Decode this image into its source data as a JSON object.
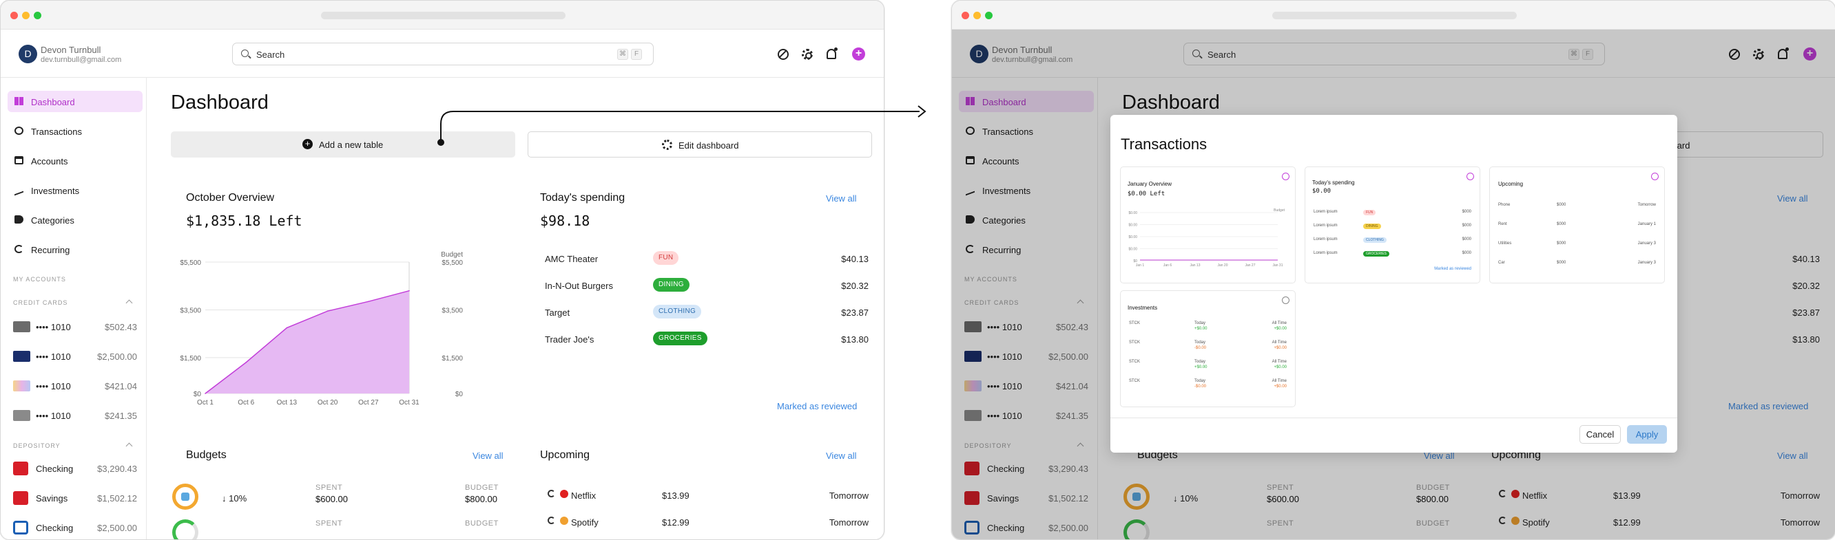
{
  "user": {
    "initial": "D",
    "name": "Devon Turnbull",
    "email": "dev.turnbull@gmail.com"
  },
  "search": {
    "placeholder": "Search",
    "shortcut_key1": "⌘",
    "shortcut_key2": "F"
  },
  "nav": [
    {
      "label": "Dashboard",
      "icon": "dashboard-icon"
    },
    {
      "label": "Transactions",
      "icon": "transactions-icon"
    },
    {
      "label": "Accounts",
      "icon": "accounts-icon"
    },
    {
      "label": "Investments",
      "icon": "investments-icon"
    },
    {
      "label": "Categories",
      "icon": "categories-icon"
    },
    {
      "label": "Recurring",
      "icon": "recurring-icon"
    }
  ],
  "sidebar": {
    "my_accounts": "MY ACCOUNTS",
    "credit_cards": "CREDIT CARDS",
    "depository": "DEPOSITORY",
    "cards": [
      {
        "name": "•••• 1010",
        "balance": "$502.43",
        "color": "#6b6b6b"
      },
      {
        "name": "•••• 1010",
        "balance": "$2,500.00",
        "color": "#1a2e6b"
      },
      {
        "name": "•••• 1010",
        "balance": "$421.04",
        "color": "#e8b4e6"
      },
      {
        "name": "•••• 1010",
        "balance": "$241.35",
        "color": "#8a8a8a"
      }
    ],
    "deposits": [
      {
        "name": "Checking",
        "balance": "$3,290.43",
        "bank": "wells-fargo"
      },
      {
        "name": "Savings",
        "balance": "$1,502.12",
        "bank": "wells-fargo"
      },
      {
        "name": "Checking",
        "balance": "$2,500.00",
        "bank": "chase"
      }
    ]
  },
  "dashboard": {
    "title": "Dashboard",
    "add_table": "Add a new table",
    "edit_dashboard": "Edit dashboard",
    "overview": {
      "title": "October Overview",
      "amount": "$1,835.18 Left"
    },
    "spending": {
      "title": "Today's spending",
      "amount": "$98.18",
      "view_all": "View all",
      "marked": "Marked as reviewed",
      "rows": [
        {
          "name": "AMC Theater",
          "badge": "FUN",
          "amount": "$40.13"
        },
        {
          "name": "In-N-Out Burgers",
          "badge": "DINING",
          "amount": "$20.32"
        },
        {
          "name": "Target",
          "badge": "CLOTHING",
          "amount": "$23.87"
        },
        {
          "name": "Trader Joe's",
          "badge": "GROCERIES",
          "amount": "$13.80"
        }
      ]
    },
    "budgets": {
      "title": "Budgets",
      "view_all": "View all",
      "spent_label": "SPENT",
      "budget_label": "BUDGET",
      "rows": [
        {
          "pct": "↓ 10%",
          "spent": "$600.00",
          "budget": "$800.00"
        }
      ]
    },
    "upcoming": {
      "title": "Upcoming",
      "view_all": "View all",
      "rows": [
        {
          "name": "Netflix",
          "amount": "$13.99",
          "when": "Tomorrow"
        },
        {
          "name": "Spotify",
          "amount": "$12.99",
          "when": "Tomorrow"
        }
      ]
    }
  },
  "chart_data": {
    "type": "area",
    "x": [
      "Oct 1",
      "Oct 6",
      "Oct 13",
      "Oct 20",
      "Oct 27",
      "Oct 31"
    ],
    "values": [
      0,
      1300,
      2750,
      3450,
      3850,
      4300
    ],
    "y_ticks": [
      "$0",
      "$1,500",
      "$3,500",
      "$5,500"
    ],
    "right_ticks": [
      "$0",
      "$1,500",
      "$3,500",
      "$5,500"
    ],
    "right_title": "Budget",
    "ylim": [
      0,
      5500
    ],
    "color": "#e6b9f3"
  },
  "modal": {
    "title": "Transactions",
    "cancel": "Cancel",
    "apply": "Apply",
    "cards": {
      "overview": {
        "title": "January Overview",
        "amount": "$0.00 Left",
        "budget": "Budget"
      },
      "spending": {
        "title": "Today's spending",
        "amount": "$0.00",
        "marked": "Marked as reviewed"
      },
      "upcoming": {
        "title": "Upcoming"
      },
      "investments": {
        "title": "Investments"
      }
    },
    "overview_y": [
      "$0.00",
      "$0.00",
      "$0.00",
      "$0.00",
      "$0"
    ],
    "overview_x": [
      "Jan 1",
      "Jan 6",
      "Jan 13",
      "Jan 20",
      "Jan 27",
      "Jan 31"
    ],
    "spending_rows": [
      {
        "name": "Lorem ipsum",
        "badge": "FUN",
        "amount": "$000"
      },
      {
        "name": "Lorem ipsum",
        "badge": "DINING",
        "amount": "$000"
      },
      {
        "name": "Lorem ipsum",
        "badge": "CLOTHING",
        "amount": "$000"
      },
      {
        "name": "Lorem ipsum",
        "badge": "GROCERIES",
        "amount": "$000"
      }
    ],
    "upcoming_rows": [
      {
        "name": "Phone",
        "amount": "$000",
        "when": "Tomorrow"
      },
      {
        "name": "Rent",
        "amount": "$000",
        "when": "January 1"
      },
      {
        "name": "Utilities",
        "amount": "$000",
        "when": "January 3"
      },
      {
        "name": "Car",
        "amount": "$000",
        "when": "January 3"
      }
    ],
    "invest_rows": [
      {
        "name": "STCK",
        "today": "Today",
        "today_val": "+$0.00",
        "all": "All Time",
        "all_val": "+$0.00"
      },
      {
        "name": "STCK",
        "today": "Today",
        "today_val": "-$0.00",
        "all": "All Time",
        "all_val": "+$0.00"
      },
      {
        "name": "STCK",
        "today": "Today",
        "today_val": "+$0.00",
        "all": "All Time",
        "all_val": "+$0.00"
      },
      {
        "name": "STCK",
        "today": "Today",
        "today_val": "-$0.00",
        "all": "All Time",
        "all_val": "+$0.00"
      }
    ]
  }
}
